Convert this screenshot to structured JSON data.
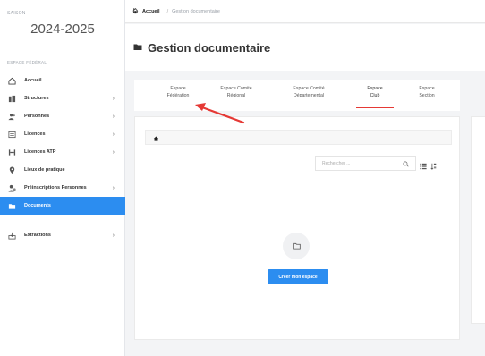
{
  "sidebar": {
    "season_label": "SAISON",
    "season_year": "2024-2025",
    "espace_label": "ESPACE FÉDÉRAL",
    "items": [
      {
        "label": "Accueil",
        "icon": "home-icon",
        "chevron": false,
        "active": false
      },
      {
        "label": "Structures",
        "icon": "building-icon",
        "chevron": true,
        "active": false
      },
      {
        "label": "Personnes",
        "icon": "users-icon",
        "chevron": true,
        "active": false
      },
      {
        "label": "Licences",
        "icon": "license-icon",
        "chevron": true,
        "active": false
      },
      {
        "label": "Licences ATP",
        "icon": "license-atp-icon",
        "chevron": true,
        "active": false
      },
      {
        "label": "Lieux de pratique",
        "icon": "location-icon",
        "chevron": false,
        "active": false
      },
      {
        "label": "Préinscriptions Personnes",
        "icon": "preregistration-icon",
        "chevron": true,
        "active": false
      },
      {
        "label": "Documents",
        "icon": "folder-icon",
        "chevron": false,
        "active": true
      }
    ],
    "extra_items": [
      {
        "label": "Extractions",
        "icon": "extraction-icon",
        "chevron": true,
        "active": false
      }
    ]
  },
  "topbar": {
    "breadcrumb_home": "Accueil",
    "breadcrumb_separator": "/",
    "breadcrumb_current": "Gestion documentaire"
  },
  "page": {
    "title": "Gestion documentaire"
  },
  "tabs": [
    {
      "line1": "Espace",
      "line2": "Fédération",
      "active": false
    },
    {
      "line1": "Espace Comité",
      "line2": "Régional",
      "active": false
    },
    {
      "line1": "Espace Comité",
      "line2": "Départemental",
      "active": false
    },
    {
      "line1": "Espace",
      "line2": "Club",
      "active": true
    },
    {
      "line1": "Espace",
      "line2": "Section",
      "active": false
    }
  ],
  "content": {
    "search_placeholder": "Rechercher ...",
    "create_button_label": "Créer mon espace"
  },
  "colors": {
    "accent": "#2c8df0",
    "active_tab_underline": "#e53935",
    "annotation_arrow": "#e53935"
  }
}
